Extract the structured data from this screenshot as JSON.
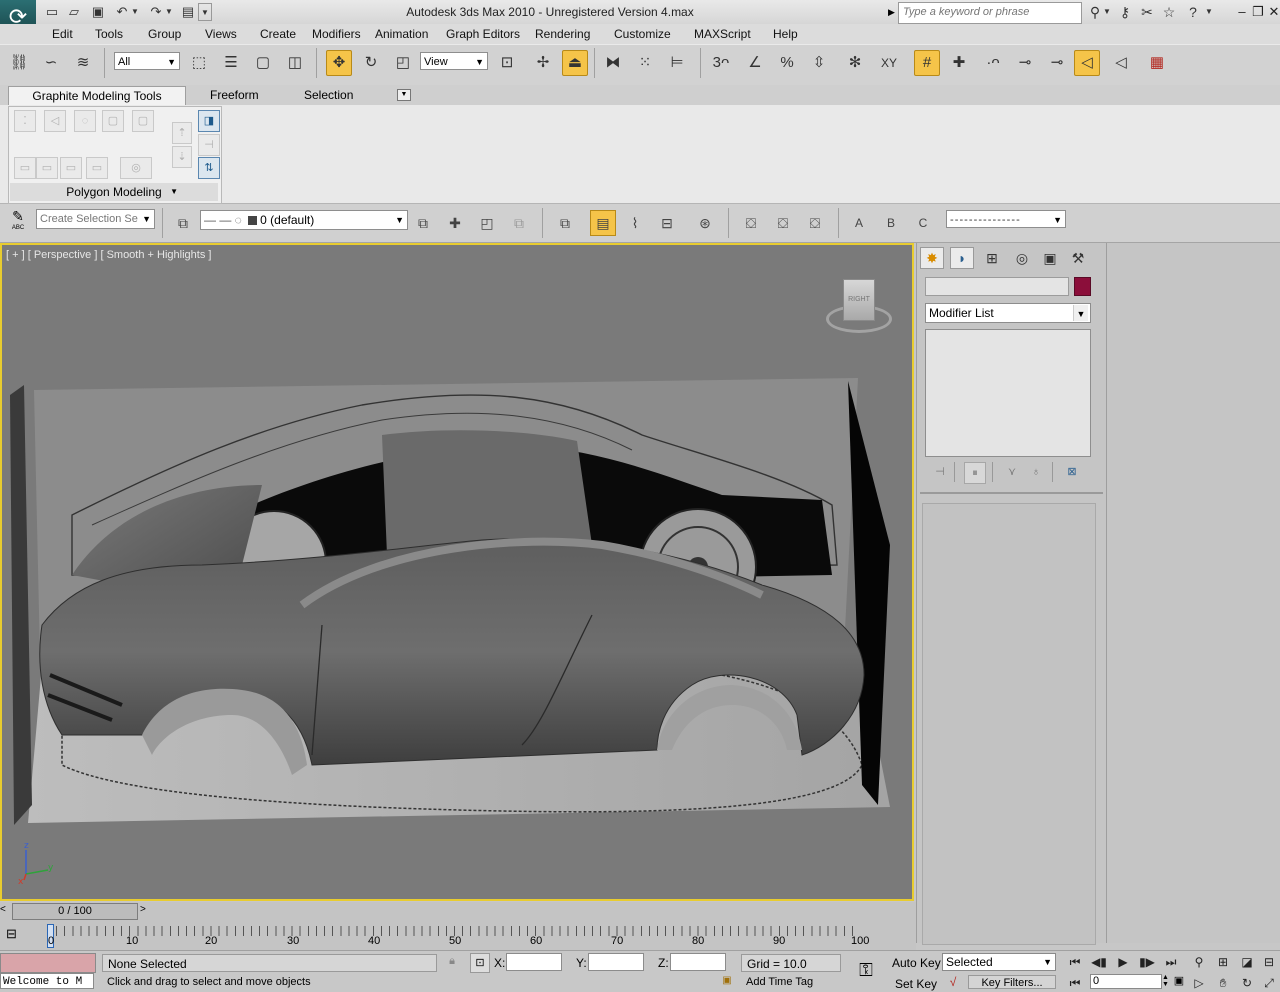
{
  "titlebar": {
    "title": "Autodesk 3ds Max  2010   - Unregistered Version     4.max",
    "search_placeholder": "Type a keyword or phrase"
  },
  "menu": [
    "Edit",
    "Tools",
    "Group",
    "Views",
    "Create",
    "Modifiers",
    "Animation",
    "Graph Editors",
    "Rendering",
    "Customize",
    "MAXScript",
    "Help"
  ],
  "main_toolbar": {
    "selection_filter": "All",
    "reference_coord": "View"
  },
  "ribbon": {
    "tabs": [
      "Graphite Modeling Tools",
      "Freeform",
      "Selection"
    ],
    "panel_label": "Polygon Modeling"
  },
  "layer_toolbar": {
    "named_selection_placeholder": "Create Selection Se",
    "layer": "0 (default)",
    "abc_label": "ABC"
  },
  "viewport": {
    "label": "[ + ] [ Perspective ] [ Smooth + Highlights ]",
    "viewcube_face": "RIGHT",
    "axis_labels": {
      "z": "z",
      "y": "y",
      "x": "x"
    }
  },
  "command_panel": {
    "object_name": "",
    "object_color": "#8b0e3a",
    "modifier_list": "Modifier List"
  },
  "time_slider": {
    "frame_display": "0 / 100",
    "ticks": [
      "0",
      "10",
      "20",
      "30",
      "40",
      "50",
      "60",
      "70",
      "80",
      "90",
      "100"
    ]
  },
  "status": {
    "maxscript_output": "Welcome to M",
    "selection_info": "None Selected",
    "prompt": "Click and drag to select and move objects",
    "coord_labels": {
      "x": "X:",
      "y": "Y:",
      "z": "Z:"
    },
    "grid": "Grid = 10.0",
    "auto_key": "Auto Key",
    "set_key": "Set Key",
    "key_mode": "Selected",
    "key_filters": "Key Filters...",
    "add_time_tag": "Add Time Tag",
    "current_frame": "0"
  },
  "accent": {
    "active_button": "#f5c449",
    "viewport_border": "#e8cc2f"
  }
}
